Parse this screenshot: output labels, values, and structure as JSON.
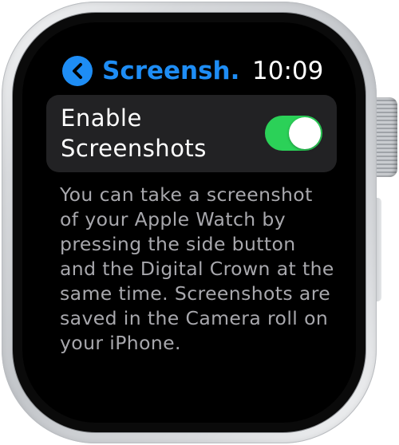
{
  "nav": {
    "back_icon": "chevron-left-icon",
    "title": "Screensh...",
    "time": "10:09"
  },
  "setting": {
    "label_line1": "Enable",
    "label_line2": "Screenshots",
    "enabled": true,
    "on_color": "#2bd158"
  },
  "description": "You can take a screenshot of your Apple Watch by pressing the side button and the Digital Crown at the same time. Screenshots are saved in the Camera roll on your iPhone.",
  "colors": {
    "accent": "#1e8df5",
    "row_background": "#222224",
    "secondary_text": "#a8a8ad"
  }
}
